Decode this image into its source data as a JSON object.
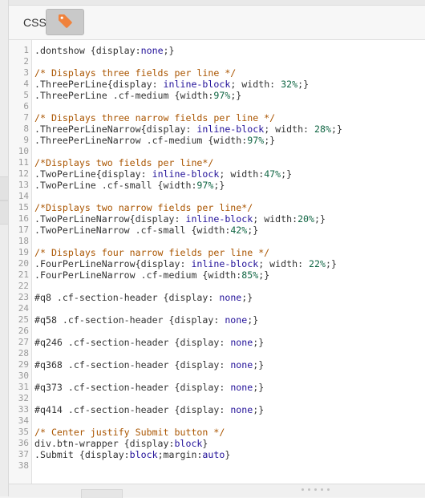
{
  "panel": {
    "title": "CSS",
    "tag_button_icon": "tag-icon",
    "accent_color": "#f0823c"
  },
  "editor": {
    "colors": {
      "comment": "#aa5500",
      "keyword": "#221199",
      "number": "#116644",
      "default": "#333333"
    },
    "lines": [
      [
        {
          "t": "s",
          "v": ".dontshow {display:"
        },
        {
          "t": "k",
          "v": "none"
        },
        {
          "t": "s",
          "v": ";}"
        }
      ],
      [],
      [
        {
          "t": "c",
          "v": "/* Displays three fields per line */"
        }
      ],
      [
        {
          "t": "s",
          "v": ".ThreePerLine{display: "
        },
        {
          "t": "k",
          "v": "inline-block"
        },
        {
          "t": "s",
          "v": "; width: "
        },
        {
          "t": "n",
          "v": "32%"
        },
        {
          "t": "s",
          "v": ";}"
        }
      ],
      [
        {
          "t": "s",
          "v": ".ThreePerLine .cf-medium {width:"
        },
        {
          "t": "n",
          "v": "97%"
        },
        {
          "t": "s",
          "v": ";}"
        }
      ],
      [],
      [
        {
          "t": "c",
          "v": "/* Displays three narrow fields per line */"
        }
      ],
      [
        {
          "t": "s",
          "v": ".ThreePerLineNarrow{display: "
        },
        {
          "t": "k",
          "v": "inline-block"
        },
        {
          "t": "s",
          "v": "; width: "
        },
        {
          "t": "n",
          "v": "28%"
        },
        {
          "t": "s",
          "v": ";}"
        }
      ],
      [
        {
          "t": "s",
          "v": ".ThreePerLineNarrow .cf-medium {width:"
        },
        {
          "t": "n",
          "v": "97%"
        },
        {
          "t": "s",
          "v": ";}"
        }
      ],
      [],
      [
        {
          "t": "c",
          "v": "/*Displays two fields per line*/"
        }
      ],
      [
        {
          "t": "s",
          "v": ".TwoPerLine{display: "
        },
        {
          "t": "k",
          "v": "inline-block"
        },
        {
          "t": "s",
          "v": "; width:"
        },
        {
          "t": "n",
          "v": "47%"
        },
        {
          "t": "s",
          "v": ";}"
        }
      ],
      [
        {
          "t": "s",
          "v": ".TwoPerLine .cf-small {width:"
        },
        {
          "t": "n",
          "v": "97%"
        },
        {
          "t": "s",
          "v": ";}"
        }
      ],
      [],
      [
        {
          "t": "c",
          "v": "/*Displays two narrow fields per line*/"
        }
      ],
      [
        {
          "t": "s",
          "v": ".TwoPerLineNarrow{display: "
        },
        {
          "t": "k",
          "v": "inline-block"
        },
        {
          "t": "s",
          "v": "; width:"
        },
        {
          "t": "n",
          "v": "20%"
        },
        {
          "t": "s",
          "v": ";}"
        }
      ],
      [
        {
          "t": "s",
          "v": ".TwoPerLineNarrow .cf-small {width:"
        },
        {
          "t": "n",
          "v": "42%"
        },
        {
          "t": "s",
          "v": ";}"
        }
      ],
      [],
      [
        {
          "t": "c",
          "v": "/* Displays four narrow fields per line */"
        }
      ],
      [
        {
          "t": "s",
          "v": ".FourPerLineNarrow{display: "
        },
        {
          "t": "k",
          "v": "inline-block"
        },
        {
          "t": "s",
          "v": "; width: "
        },
        {
          "t": "n",
          "v": "22%"
        },
        {
          "t": "s",
          "v": ";}"
        }
      ],
      [
        {
          "t": "s",
          "v": ".FourPerLineNarrow .cf-medium {width:"
        },
        {
          "t": "n",
          "v": "85%"
        },
        {
          "t": "s",
          "v": ";}"
        }
      ],
      [],
      [
        {
          "t": "i",
          "v": "#q8"
        },
        {
          "t": "s",
          "v": " .cf-section-header {display: "
        },
        {
          "t": "k",
          "v": "none"
        },
        {
          "t": "s",
          "v": ";}"
        }
      ],
      [],
      [
        {
          "t": "i",
          "v": "#q58"
        },
        {
          "t": "s",
          "v": " .cf-section-header {display: "
        },
        {
          "t": "k",
          "v": "none"
        },
        {
          "t": "s",
          "v": ";}"
        }
      ],
      [],
      [
        {
          "t": "i",
          "v": "#q246"
        },
        {
          "t": "s",
          "v": " .cf-section-header {display: "
        },
        {
          "t": "k",
          "v": "none"
        },
        {
          "t": "s",
          "v": ";}"
        }
      ],
      [],
      [
        {
          "t": "i",
          "v": "#q368"
        },
        {
          "t": "s",
          "v": " .cf-section-header {display: "
        },
        {
          "t": "k",
          "v": "none"
        },
        {
          "t": "s",
          "v": ";}"
        }
      ],
      [],
      [
        {
          "t": "i",
          "v": "#q373"
        },
        {
          "t": "s",
          "v": " .cf-section-header {display: "
        },
        {
          "t": "k",
          "v": "none"
        },
        {
          "t": "s",
          "v": ";}"
        }
      ],
      [],
      [
        {
          "t": "i",
          "v": "#q414"
        },
        {
          "t": "s",
          "v": " .cf-section-header {display: "
        },
        {
          "t": "k",
          "v": "none"
        },
        {
          "t": "s",
          "v": ";}"
        }
      ],
      [],
      [
        {
          "t": "c",
          "v": "/* Center justify Submit button */"
        }
      ],
      [
        {
          "t": "s",
          "v": "div.btn-wrapper {display:"
        },
        {
          "t": "k",
          "v": "block"
        },
        {
          "t": "s",
          "v": "}"
        }
      ],
      [
        {
          "t": "s",
          "v": ".Submit {display:"
        },
        {
          "t": "k",
          "v": "block"
        },
        {
          "t": "s",
          "v": ";margin:"
        },
        {
          "t": "k",
          "v": "auto"
        },
        {
          "t": "s",
          "v": "}"
        }
      ],
      []
    ]
  }
}
